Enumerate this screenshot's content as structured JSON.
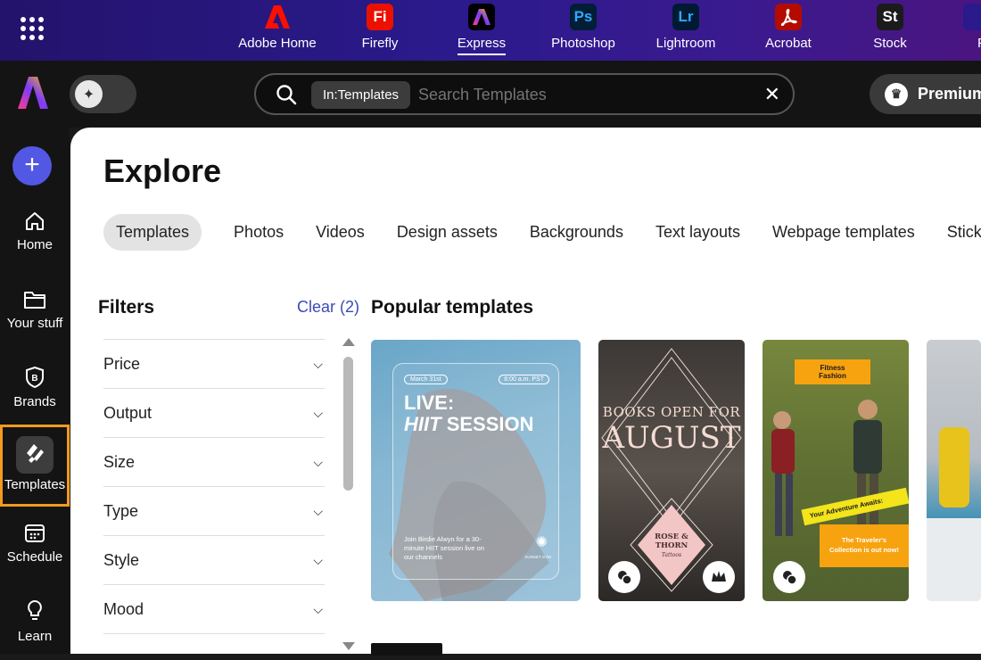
{
  "apps": [
    {
      "label": "Adobe Home",
      "icon": "adobe-home-icon",
      "glyph": "A",
      "color": "#e01f1f"
    },
    {
      "label": "Firefly",
      "icon": "firefly-icon",
      "glyph": "Fi",
      "color": "#e01f1f"
    },
    {
      "label": "Express",
      "icon": "express-icon",
      "glyph": "A",
      "color": "#111111"
    },
    {
      "label": "Photoshop",
      "icon": "photoshop-icon",
      "glyph": "Ps",
      "color": "#0a2a4a"
    },
    {
      "label": "Lightroom",
      "icon": "lightroom-icon",
      "glyph": "Lr",
      "color": "#0a2a4a"
    },
    {
      "label": "Acrobat",
      "icon": "acrobat-icon",
      "glyph": "A",
      "color": "#c4141b"
    },
    {
      "label": "Stock",
      "icon": "stock-icon",
      "glyph": "St",
      "color": "#1a1a1a"
    },
    {
      "label": "F",
      "icon": "app-icon",
      "glyph": "",
      "color": "#2a1a8c"
    }
  ],
  "search": {
    "chip": "In:Templates",
    "placeholder": "Search Templates",
    "close": "✕"
  },
  "premium": {
    "label": "Premium"
  },
  "nav": {
    "home": "Home",
    "your_stuff": "Your stuff",
    "brands": "Brands",
    "templates": "Templates",
    "schedule": "Schedule",
    "learn": "Learn"
  },
  "main": {
    "title": "Explore",
    "tabs": [
      "Templates",
      "Photos",
      "Videos",
      "Design assets",
      "Backgrounds",
      "Text layouts",
      "Webpage templates",
      "Stickers"
    ],
    "filters_heading": "Filters",
    "clear": "Clear (2)",
    "filters": [
      "Price",
      "Output",
      "Size",
      "Type",
      "Style",
      "Mood"
    ],
    "popular_heading": "Popular templates"
  },
  "cards": {
    "hiit": {
      "date": "March 31st",
      "time": "8:00 a.m. PST",
      "line1": "LIVE:",
      "line2a": "HIIT",
      "line2b": "SESSION",
      "body": "Join Birdie Alwyn for a 30-minute HIIT session live on our channels",
      "brand": "SUNSET GYM"
    },
    "books": {
      "line1": "BOOKS OPEN FOR",
      "line2": "AUGUST",
      "tag1": "ROSE &",
      "tag2": "THORN",
      "tag3": "Tattoos"
    },
    "travel": {
      "brand1": "Fitness",
      "brand2": "Fashion",
      "banner": "Your Adventure Awaits:",
      "promo1": "The Traveler's",
      "promo2": "Collection is out now!"
    }
  },
  "colors": {
    "accent": "#5258e4",
    "active_outline": "#f39a1f",
    "clear_link": "#3b4ab8",
    "promo": "#f7a310"
  }
}
